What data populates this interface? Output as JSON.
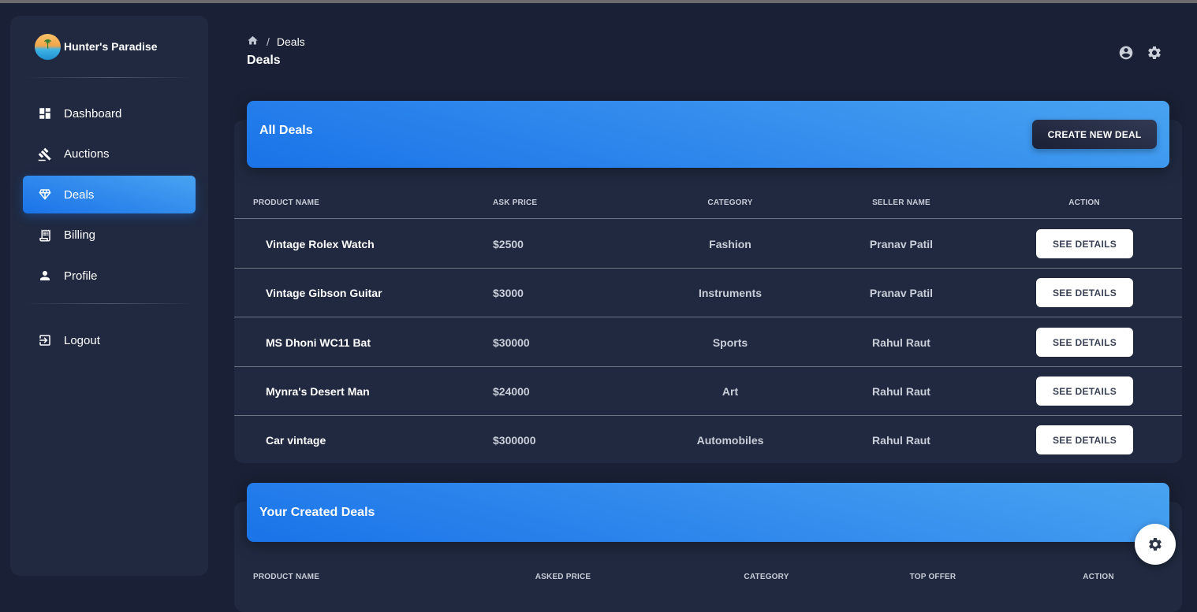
{
  "brand": {
    "name": "Hunter's Paradise"
  },
  "sidebar": {
    "items": [
      {
        "label": "Dashboard",
        "icon": "dashboard-icon",
        "active": false
      },
      {
        "label": "Auctions",
        "icon": "gavel-icon",
        "active": false
      },
      {
        "label": "Deals",
        "icon": "diamond-icon",
        "active": true
      },
      {
        "label": "Billing",
        "icon": "receipt-icon",
        "active": false
      },
      {
        "label": "Profile",
        "icon": "person-icon",
        "active": false
      }
    ],
    "logout": {
      "label": "Logout",
      "icon": "logout-icon"
    }
  },
  "header": {
    "breadcrumb_current": "Deals",
    "title": "Deals",
    "icons": [
      "account-circle-icon",
      "gear-icon"
    ]
  },
  "all_deals": {
    "title": "All Deals",
    "create_button": "CREATE NEW DEAL",
    "columns": [
      "PRODUCT NAME",
      "ASK PRICE",
      "CATEGORY",
      "SELLER NAME",
      "ACTION"
    ],
    "rows": [
      {
        "product": "Vintage Rolex Watch",
        "price": "$2500",
        "category": "Fashion",
        "seller": "Pranav Patil",
        "action": "SEE DETAILS"
      },
      {
        "product": "Vintage Gibson Guitar",
        "price": "$3000",
        "category": "Instruments",
        "seller": "Pranav Patil",
        "action": "SEE DETAILS"
      },
      {
        "product": "MS Dhoni WC11 Bat",
        "price": "$30000",
        "category": "Sports",
        "seller": "Rahul Raut",
        "action": "SEE DETAILS"
      },
      {
        "product": "Mynra's Desert Man",
        "price": "$24000",
        "category": "Art",
        "seller": "Rahul Raut",
        "action": "SEE DETAILS"
      },
      {
        "product": "Car vintage",
        "price": "$300000",
        "category": "Automobiles",
        "seller": "Rahul Raut",
        "action": "SEE DETAILS"
      }
    ]
  },
  "your_deals": {
    "title": "Your Created Deals",
    "columns": [
      "PRODUCT NAME",
      "ASKED PRICE",
      "CATEGORY",
      "TOP OFFER",
      "ACTION"
    ]
  },
  "colors": {
    "background": "#1a2035",
    "card": "#202940",
    "accent_start": "#49a3f1",
    "accent_end": "#1a73e8"
  }
}
